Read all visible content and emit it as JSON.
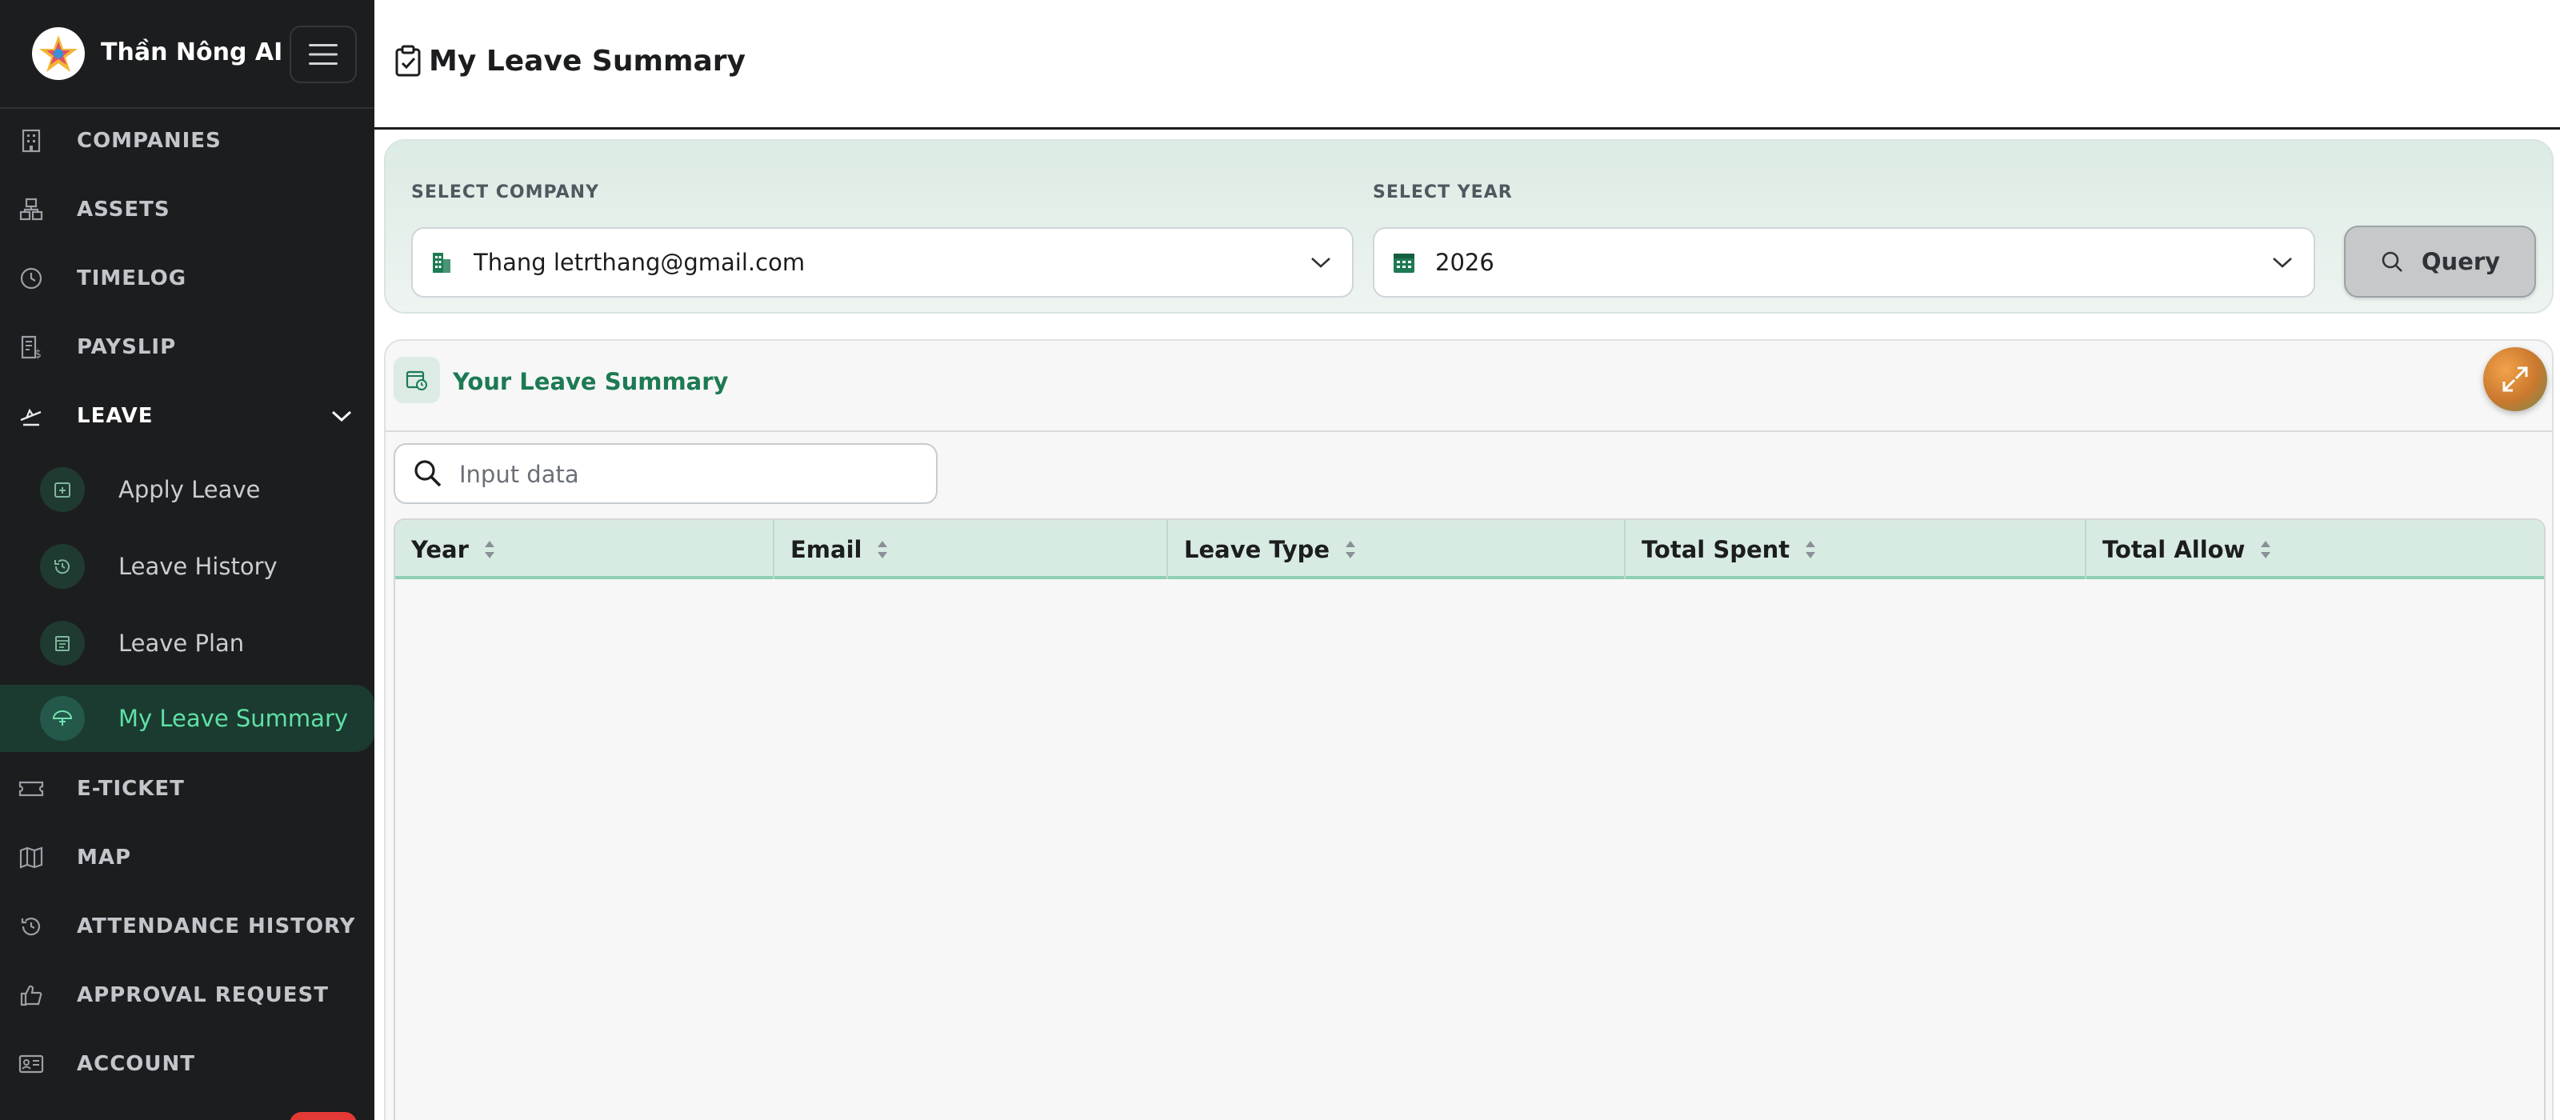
{
  "app": {
    "name": "Thần Nông AI"
  },
  "sidebar": {
    "items": [
      {
        "label": "COMPANIES",
        "icon": "building-icon"
      },
      {
        "label": "ASSETS",
        "icon": "assets-icon"
      },
      {
        "label": "TIMELOG",
        "icon": "clock-icon"
      },
      {
        "label": "PAYSLIP",
        "icon": "payslip-icon"
      },
      {
        "label": "LEAVE",
        "icon": "leave-icon",
        "expanded": true
      }
    ],
    "leave_subitems": [
      {
        "label": "Apply Leave",
        "icon": "apply-leave-icon"
      },
      {
        "label": "Leave History",
        "icon": "history-icon"
      },
      {
        "label": "Leave Plan",
        "icon": "calendar-icon"
      },
      {
        "label": "My Leave Summary",
        "icon": "umbrella-icon",
        "active": true
      }
    ],
    "items_after": [
      {
        "label": "E-TICKET",
        "icon": "ticket-icon"
      },
      {
        "label": "MAP",
        "icon": "map-icon"
      },
      {
        "label": "ATTENDANCE HISTORY",
        "icon": "attendance-icon"
      },
      {
        "label": "APPROVAL REQUEST",
        "icon": "thumbs-up-icon"
      },
      {
        "label": "ACCOUNT",
        "icon": "id-card-icon"
      }
    ]
  },
  "header": {
    "title": "My Leave Summary"
  },
  "filters": {
    "company_label": "SELECT COMPANY",
    "company_value": "Thang letrthang@gmail.com",
    "year_label": "SELECT YEAR",
    "year_value": "2026",
    "query_label": "Query"
  },
  "summary": {
    "title": "Your Leave Summary",
    "search_placeholder": "Input data",
    "columns": [
      "Year",
      "Email",
      "Leave Type",
      "Total Spent",
      "Total Allow"
    ],
    "rows": []
  },
  "colors": {
    "sidebar_bg": "#1c1d1f",
    "active_text": "#5fe0a6",
    "accent_green": "#1d7a53",
    "table_header_bg": "#d8ebe3"
  }
}
